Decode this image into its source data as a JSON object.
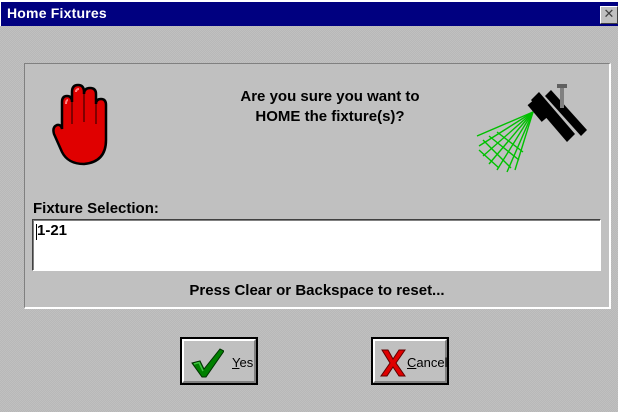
{
  "window": {
    "title": "Home Fixtures",
    "close_glyph": "✕"
  },
  "dialog": {
    "question_line1": "Are you sure you want to",
    "question_line2": "HOME the fixture(s)?",
    "stop_icon": "red-stop-hand-icon",
    "fixture_icon": "moving-light-fixture-icon"
  },
  "selection": {
    "label": "Fixture Selection:",
    "value": "1-21",
    "hint": "Press Clear or Backspace to reset..."
  },
  "buttons": {
    "yes_mnemonic": "Y",
    "yes_rest": "es",
    "cancel_mnemonic": "C",
    "cancel_rest": "ancel"
  },
  "colors": {
    "titlebar": "#000080",
    "face": "#c0c0c0",
    "hand_red": "#e00000",
    "beam_green": "#00c000",
    "check_green": "#008000",
    "cancel_red": "#e00000"
  }
}
